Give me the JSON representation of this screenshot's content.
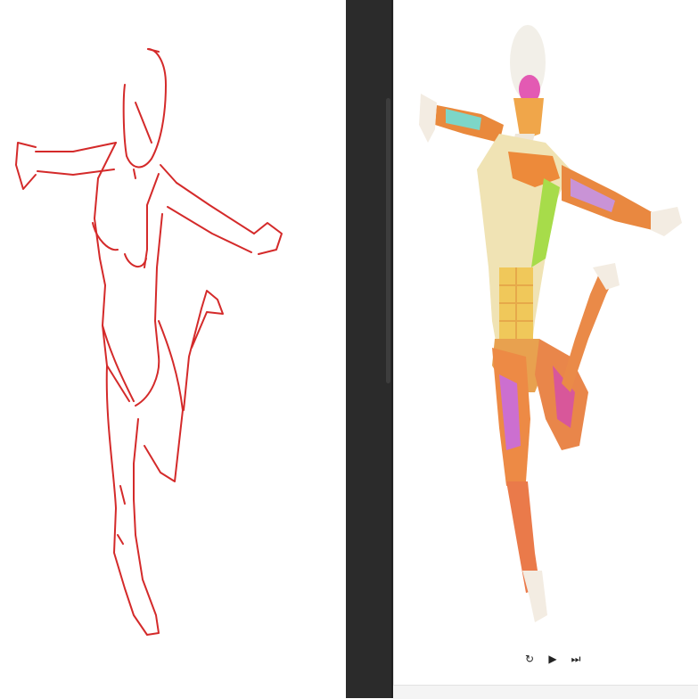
{
  "colors": {
    "sketch_stroke": "#d42a2a",
    "divider": "#2b2b2b",
    "background": "#ffffff"
  },
  "playback": {
    "replay_glyph": "↻",
    "play_glyph": "▶",
    "fast_forward_glyph": "⏭"
  }
}
